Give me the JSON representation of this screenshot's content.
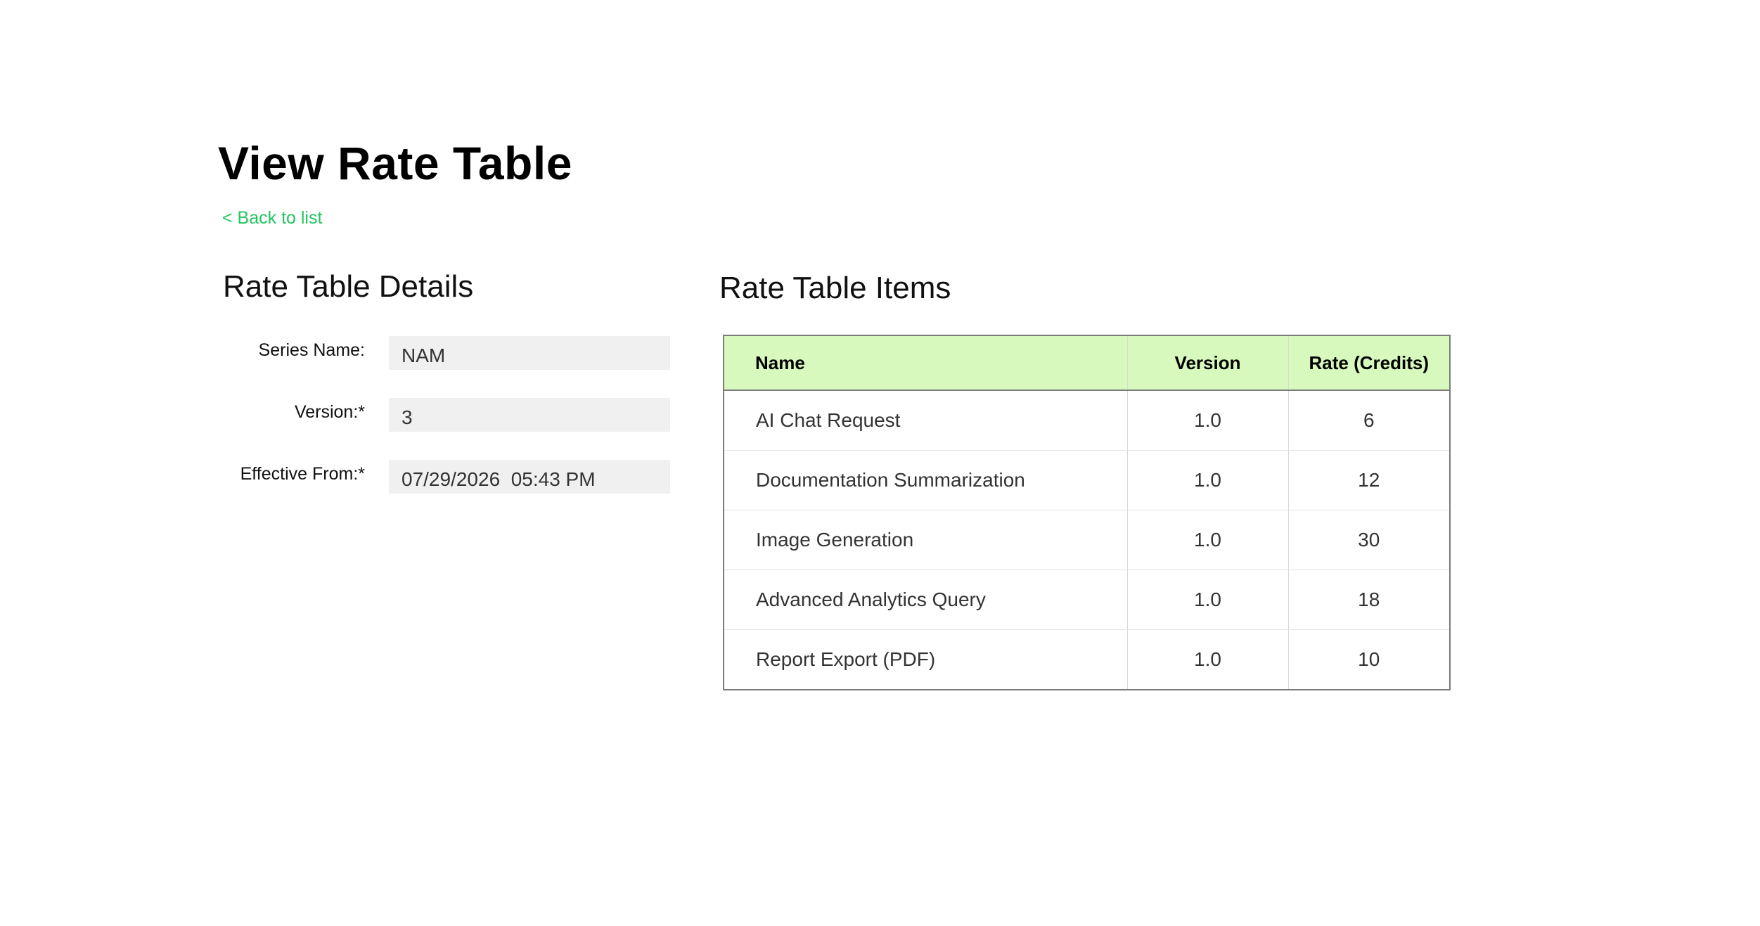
{
  "page": {
    "title": "View Rate Table",
    "back_link": "< Back to list",
    "accent_color": "#22c55e",
    "table_header_color": "#d7f9bd"
  },
  "details": {
    "heading": "Rate Table Details",
    "fields": {
      "series_name": {
        "label": "Series Name:",
        "value": "NAM"
      },
      "version": {
        "label": "Version:*",
        "value": "3"
      },
      "effective_from": {
        "label": "Effective From:*",
        "value": "07/29/2026  05:43 PM"
      }
    }
  },
  "items": {
    "heading": "Rate Table Items",
    "columns": {
      "name": "Name",
      "version": "Version",
      "rate": "Rate (Credits)"
    },
    "rows": [
      {
        "name": "AI Chat Request",
        "version": "1.0",
        "rate": "6"
      },
      {
        "name": "Documentation Summarization",
        "version": "1.0",
        "rate": "12"
      },
      {
        "name": "Image Generation",
        "version": "1.0",
        "rate": "30"
      },
      {
        "name": "Advanced Analytics Query",
        "version": "1.0",
        "rate": "18"
      },
      {
        "name": "Report Export (PDF)",
        "version": "1.0",
        "rate": "10"
      }
    ]
  }
}
